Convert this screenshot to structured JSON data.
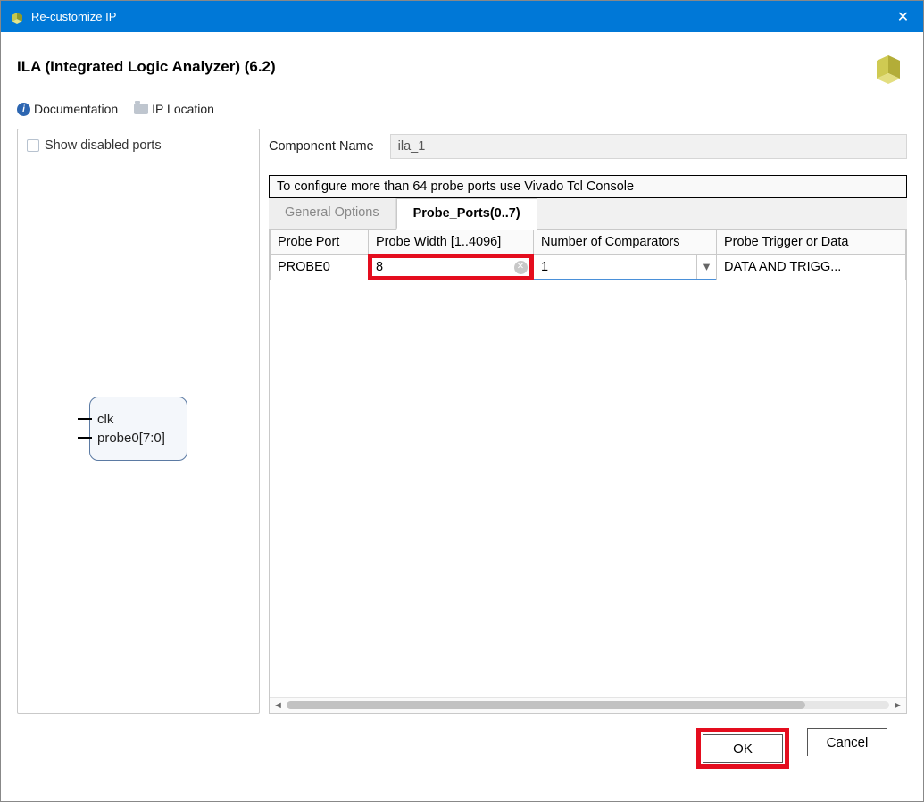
{
  "window": {
    "title": "Re-customize IP"
  },
  "ip": {
    "title": "ILA (Integrated Logic Analyzer) (6.2)"
  },
  "links": {
    "documentation": "Documentation",
    "ip_location": "IP Location"
  },
  "left_panel": {
    "show_disabled_label": "Show disabled ports",
    "ports": [
      "clk",
      "probe0[7:0]"
    ]
  },
  "component": {
    "label": "Component Name",
    "value": "ila_1"
  },
  "notice": "To configure more than 64 probe ports use Vivado Tcl Console",
  "tabs": {
    "general": "General Options",
    "probe_ports": "Probe_Ports(0..7)"
  },
  "grid": {
    "headers": [
      "Probe Port",
      "Probe Width [1..4096]",
      "Number of Comparators",
      "Probe Trigger or Data"
    ],
    "row": {
      "port": "PROBE0",
      "width": "8",
      "comparators": "1",
      "trigger": "DATA AND TRIGG..."
    }
  },
  "buttons": {
    "ok": "OK",
    "cancel": "Cancel"
  }
}
